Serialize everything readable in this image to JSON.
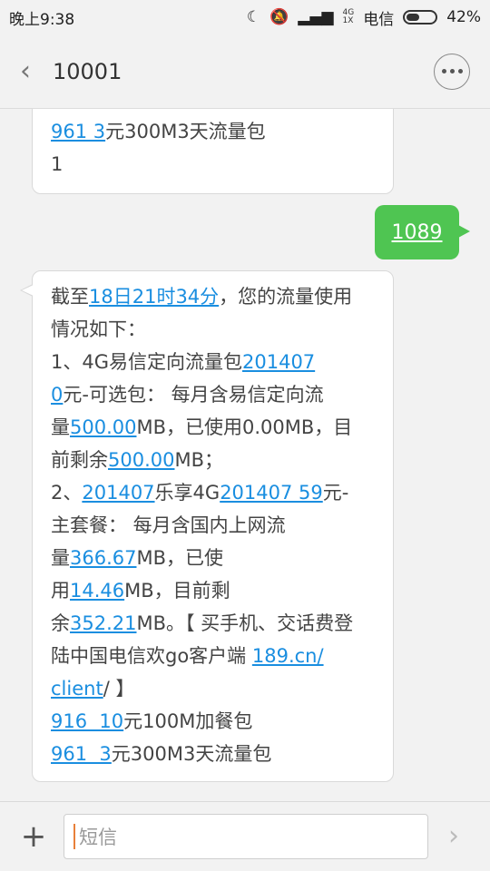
{
  "status": {
    "time": "晚上9:38",
    "net_top": "4G",
    "net_bottom": "1X",
    "carrier": "电信",
    "battery": "42%"
  },
  "header": {
    "title": "10001"
  },
  "messages": {
    "top_partial": {
      "l1_link": "961 3",
      "l1_text": "元300M3天流量包",
      "l2": "1"
    },
    "outgoing": "1089",
    "main": {
      "l1_a": "截至",
      "l1_link": "18日21时34分",
      "l1_b": "，您的流量使用",
      "l2": "情况如下：",
      "l3_a": "1、4G易信定向流量包",
      "l3_link": "201407",
      "l4_link": "0",
      "l4_b": "元-可选包： 每月含易信定向流",
      "l5_a": "量",
      "l5_link": "500.00",
      "l5_b": "MB，已使用0.00MB，目",
      "l6_a": "前剩余",
      "l6_link": "500.00",
      "l6_b": "MB；",
      "l7_a": "2、",
      "l7_link1": "201407",
      "l7_b": "乐享4G",
      "l7_link2": "201407 59",
      "l7_c": "元-",
      "l8": "主套餐： 每月含国内上网流",
      "l9_a": "量",
      "l9_link": "366.67",
      "l9_b": "MB，已使",
      "l10_a": "用",
      "l10_link": "14.46",
      "l10_b": "MB，目前剩",
      "l11_a": "余",
      "l11_link": "352.21",
      "l11_b": "MB。【 买手机、交话费登",
      "l12_a": "陆中国电信欢go客户端 ",
      "l12_link": "189.cn/",
      "l13_link": "client",
      "l13_b": "/ 】",
      "l14_link": "916  10",
      "l14_b": "元100M加餐包",
      "l15_link": "961  3",
      "l15_b": "元300M3天流量包"
    }
  },
  "input": {
    "placeholder": "短信"
  }
}
